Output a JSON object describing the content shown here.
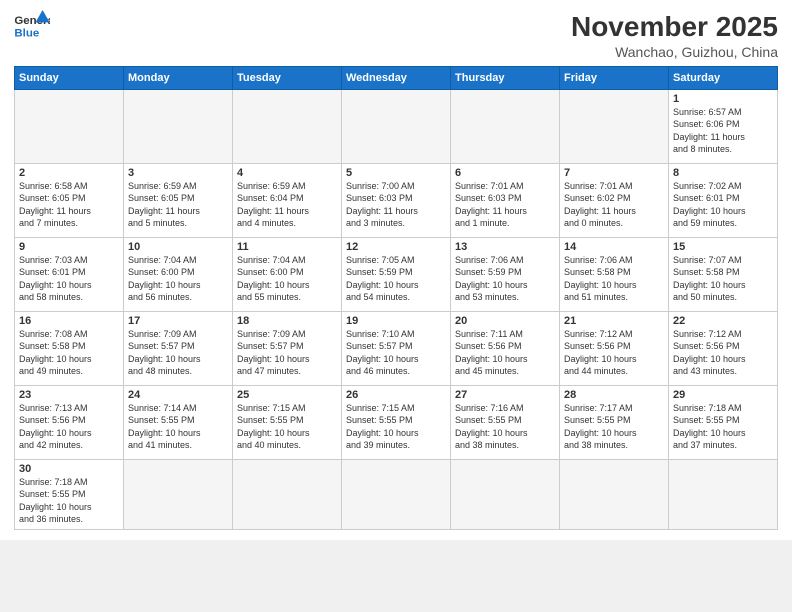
{
  "header": {
    "logo_general": "General",
    "logo_blue": "Blue",
    "month_title": "November 2025",
    "location": "Wanchao, Guizhou, China"
  },
  "days_of_week": [
    "Sunday",
    "Monday",
    "Tuesday",
    "Wednesday",
    "Thursday",
    "Friday",
    "Saturday"
  ],
  "weeks": [
    [
      {
        "day": "",
        "info": ""
      },
      {
        "day": "",
        "info": ""
      },
      {
        "day": "",
        "info": ""
      },
      {
        "day": "",
        "info": ""
      },
      {
        "day": "",
        "info": ""
      },
      {
        "day": "",
        "info": ""
      },
      {
        "day": "1",
        "info": "Sunrise: 6:57 AM\nSunset: 6:06 PM\nDaylight: 11 hours\nand 8 minutes."
      }
    ],
    [
      {
        "day": "2",
        "info": "Sunrise: 6:58 AM\nSunset: 6:05 PM\nDaylight: 11 hours\nand 7 minutes."
      },
      {
        "day": "3",
        "info": "Sunrise: 6:59 AM\nSunset: 6:05 PM\nDaylight: 11 hours\nand 5 minutes."
      },
      {
        "day": "4",
        "info": "Sunrise: 6:59 AM\nSunset: 6:04 PM\nDaylight: 11 hours\nand 4 minutes."
      },
      {
        "day": "5",
        "info": "Sunrise: 7:00 AM\nSunset: 6:03 PM\nDaylight: 11 hours\nand 3 minutes."
      },
      {
        "day": "6",
        "info": "Sunrise: 7:01 AM\nSunset: 6:03 PM\nDaylight: 11 hours\nand 1 minute."
      },
      {
        "day": "7",
        "info": "Sunrise: 7:01 AM\nSunset: 6:02 PM\nDaylight: 11 hours\nand 0 minutes."
      },
      {
        "day": "8",
        "info": "Sunrise: 7:02 AM\nSunset: 6:01 PM\nDaylight: 10 hours\nand 59 minutes."
      }
    ],
    [
      {
        "day": "9",
        "info": "Sunrise: 7:03 AM\nSunset: 6:01 PM\nDaylight: 10 hours\nand 58 minutes."
      },
      {
        "day": "10",
        "info": "Sunrise: 7:04 AM\nSunset: 6:00 PM\nDaylight: 10 hours\nand 56 minutes."
      },
      {
        "day": "11",
        "info": "Sunrise: 7:04 AM\nSunset: 6:00 PM\nDaylight: 10 hours\nand 55 minutes."
      },
      {
        "day": "12",
        "info": "Sunrise: 7:05 AM\nSunset: 5:59 PM\nDaylight: 10 hours\nand 54 minutes."
      },
      {
        "day": "13",
        "info": "Sunrise: 7:06 AM\nSunset: 5:59 PM\nDaylight: 10 hours\nand 53 minutes."
      },
      {
        "day": "14",
        "info": "Sunrise: 7:06 AM\nSunset: 5:58 PM\nDaylight: 10 hours\nand 51 minutes."
      },
      {
        "day": "15",
        "info": "Sunrise: 7:07 AM\nSunset: 5:58 PM\nDaylight: 10 hours\nand 50 minutes."
      }
    ],
    [
      {
        "day": "16",
        "info": "Sunrise: 7:08 AM\nSunset: 5:58 PM\nDaylight: 10 hours\nand 49 minutes."
      },
      {
        "day": "17",
        "info": "Sunrise: 7:09 AM\nSunset: 5:57 PM\nDaylight: 10 hours\nand 48 minutes."
      },
      {
        "day": "18",
        "info": "Sunrise: 7:09 AM\nSunset: 5:57 PM\nDaylight: 10 hours\nand 47 minutes."
      },
      {
        "day": "19",
        "info": "Sunrise: 7:10 AM\nSunset: 5:57 PM\nDaylight: 10 hours\nand 46 minutes."
      },
      {
        "day": "20",
        "info": "Sunrise: 7:11 AM\nSunset: 5:56 PM\nDaylight: 10 hours\nand 45 minutes."
      },
      {
        "day": "21",
        "info": "Sunrise: 7:12 AM\nSunset: 5:56 PM\nDaylight: 10 hours\nand 44 minutes."
      },
      {
        "day": "22",
        "info": "Sunrise: 7:12 AM\nSunset: 5:56 PM\nDaylight: 10 hours\nand 43 minutes."
      }
    ],
    [
      {
        "day": "23",
        "info": "Sunrise: 7:13 AM\nSunset: 5:56 PM\nDaylight: 10 hours\nand 42 minutes."
      },
      {
        "day": "24",
        "info": "Sunrise: 7:14 AM\nSunset: 5:55 PM\nDaylight: 10 hours\nand 41 minutes."
      },
      {
        "day": "25",
        "info": "Sunrise: 7:15 AM\nSunset: 5:55 PM\nDaylight: 10 hours\nand 40 minutes."
      },
      {
        "day": "26",
        "info": "Sunrise: 7:15 AM\nSunset: 5:55 PM\nDaylight: 10 hours\nand 39 minutes."
      },
      {
        "day": "27",
        "info": "Sunrise: 7:16 AM\nSunset: 5:55 PM\nDaylight: 10 hours\nand 38 minutes."
      },
      {
        "day": "28",
        "info": "Sunrise: 7:17 AM\nSunset: 5:55 PM\nDaylight: 10 hours\nand 38 minutes."
      },
      {
        "day": "29",
        "info": "Sunrise: 7:18 AM\nSunset: 5:55 PM\nDaylight: 10 hours\nand 37 minutes."
      }
    ],
    [
      {
        "day": "30",
        "info": "Sunrise: 7:18 AM\nSunset: 5:55 PM\nDaylight: 10 hours\nand 36 minutes."
      },
      {
        "day": "",
        "info": ""
      },
      {
        "day": "",
        "info": ""
      },
      {
        "day": "",
        "info": ""
      },
      {
        "day": "",
        "info": ""
      },
      {
        "day": "",
        "info": ""
      },
      {
        "day": "",
        "info": ""
      }
    ]
  ]
}
